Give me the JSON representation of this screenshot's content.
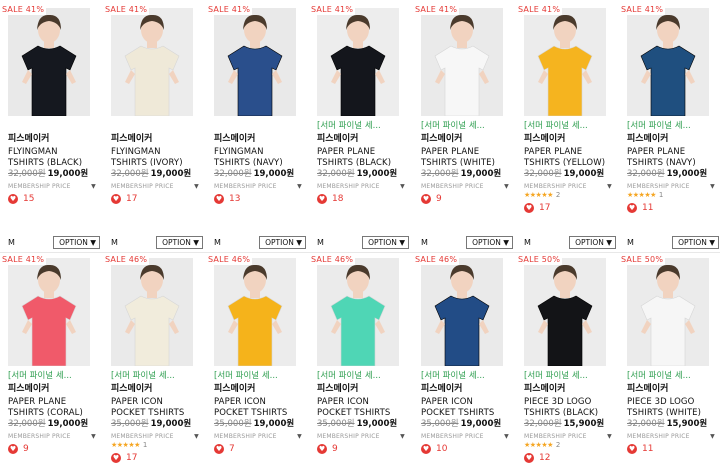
{
  "products": [
    {
      "sale": "SALE 41%",
      "tag": "",
      "brand": "피스메이커",
      "name": "FLYINGMAN\nTSHIRTS (BLACK)",
      "orig": "32,000원",
      "price": "19,000원",
      "member": "MEMBERSHIP PRICE",
      "rating": "",
      "rating_count": "",
      "likes": "15",
      "shirt": "#15181f",
      "bg": "#e9e9e9"
    },
    {
      "sale": "SALE 41%",
      "tag": "",
      "brand": "피스메이커",
      "name": "FLYINGMAN\nTSHIRTS (IVORY)",
      "orig": "32,000원",
      "price": "19,000원",
      "member": "MEMBERSHIP PRICE",
      "rating": "",
      "rating_count": "",
      "likes": "17",
      "shirt": "#efe9d8",
      "bg": "#ececec"
    },
    {
      "sale": "SALE 41%",
      "tag": "",
      "brand": "피스메이커",
      "name": "FLYINGMAN\nTSHIRTS (NAVY)",
      "orig": "32,000원",
      "price": "19,000원",
      "member": "MEMBERSHIP PRICE",
      "rating": "",
      "rating_count": "",
      "likes": "13",
      "shirt": "#2a4f8c",
      "bg": "#e9e9e9"
    },
    {
      "sale": "SALE 41%",
      "tag": "[서머 파이널 세...",
      "brand": "피스메이커",
      "name": "PAPER PLANE\nTSHIRTS (BLACK)",
      "orig": "32,000원",
      "price": "19,000원",
      "member": "MEMBERSHIP PRICE",
      "rating": "",
      "rating_count": "",
      "likes": "18",
      "shirt": "#14161c",
      "bg": "#ededed"
    },
    {
      "sale": "SALE 41%",
      "tag": "[서머 파이널 세...",
      "brand": "피스메이커",
      "name": "PAPER PLANE\nTSHIRTS (WHITE)",
      "orig": "32,000원",
      "price": "19,000원",
      "member": "MEMBERSHIP PRICE",
      "rating": "",
      "rating_count": "",
      "likes": "9",
      "shirt": "#f7f7f7",
      "bg": "#eaeaea"
    },
    {
      "sale": "SALE 41%",
      "tag": "[서머 파이널 세...",
      "brand": "피스메이커",
      "name": "PAPER PLANE\nTSHIRTS (YELLOW)",
      "orig": "32,000원",
      "price": "19,000원",
      "member": "MEMBERSHIP PRICE",
      "rating": "★★★★★",
      "rating_count": "2",
      "likes": "17",
      "shirt": "#f5b41f",
      "bg": "#ececec"
    },
    {
      "sale": "SALE 41%",
      "tag": "[서머 파이널 세...",
      "brand": "피스메이커",
      "name": "PAPER PLANE\nTSHIRTS (NAVY)",
      "orig": "32,000원",
      "price": "19,000원",
      "member": "MEMBERSHIP PRICE",
      "rating": "★★★★★",
      "rating_count": "1",
      "likes": "11",
      "shirt": "#1f4f7f",
      "bg": "#ebebeb"
    },
    {
      "sale": "SALE 41%",
      "tag": "[서머 파이널 세...",
      "brand": "피스메이커",
      "name": "PAPER PLANE\nTSHIRTS (CORAL)",
      "orig": "32,000원",
      "price": "19,000원",
      "member": "MEMBERSHIP PRICE",
      "rating": "",
      "rating_count": "",
      "likes": "9",
      "shirt": "#f05a6a",
      "bg": "#ececec"
    },
    {
      "sale": "SALE 46%",
      "tag": "[서머 파이널 세...",
      "brand": "피스메이커",
      "name": "PAPER ICON\nPOCKET TSHIRTS",
      "orig": "35,000원",
      "price": "19,000원",
      "member": "MEMBERSHIP PRICE",
      "rating": "★★★★★",
      "rating_count": "1",
      "likes": "17",
      "shirt": "#f1ecdc",
      "bg": "#eaeaea"
    },
    {
      "sale": "SALE 46%",
      "tag": "[서머 파이널 세...",
      "brand": "피스메이커",
      "name": "PAPER ICON\nPOCKET TSHIRTS",
      "orig": "35,000원",
      "price": "19,000원",
      "member": "MEMBERSHIP PRICE",
      "rating": "",
      "rating_count": "",
      "likes": "7",
      "shirt": "#f5b31b",
      "bg": "#ececec"
    },
    {
      "sale": "SALE 46%",
      "tag": "[서머 파이널 세...",
      "brand": "피스메이커",
      "name": "PAPER ICON\nPOCKET TSHIRTS",
      "orig": "35,000원",
      "price": "19,000원",
      "member": "MEMBERSHIP PRICE",
      "rating": "",
      "rating_count": "",
      "likes": "9",
      "shirt": "#4fd6b5",
      "bg": "#ebebeb"
    },
    {
      "sale": "SALE 46%",
      "tag": "[서머 파이널 세...",
      "brand": "피스메이커",
      "name": "PAPER ICON\nPOCKET TSHIRTS",
      "orig": "35,000원",
      "price": "19,000원",
      "member": "MEMBERSHIP PRICE",
      "rating": "",
      "rating_count": "",
      "likes": "10",
      "shirt": "#224c86",
      "bg": "#eaeaea"
    },
    {
      "sale": "SALE 50%",
      "tag": "[서머 파이널 세...",
      "brand": "피스메이커",
      "name": "PIECE 3D LOGO\nTSHIRTS (BLACK)",
      "orig": "32,000원",
      "price": "15,900원",
      "member": "MEMBERSHIP PRICE",
      "rating": "★★★★★",
      "rating_count": "2",
      "likes": "12",
      "shirt": "#131417",
      "bg": "#ececec"
    },
    {
      "sale": "SALE 50%",
      "tag": "[서머 파이널 세...",
      "brand": "피스메이커",
      "name": "PIECE 3D LOGO\nTSHIRTS (WHITE)",
      "orig": "32,000원",
      "price": "15,900원",
      "member": "MEMBERSHIP PRICE",
      "rating": "",
      "rating_count": "",
      "likes": "11",
      "shirt": "#f6f6f6",
      "bg": "#ebebeb"
    }
  ],
  "size_label": "M",
  "option_label": "OPTION ▼",
  "caret": "▼",
  "heart_glyph": "♥",
  "colors": {
    "sale": "#e53935",
    "tag": "#2e9e4f",
    "heart": "#e53935",
    "star": "#f5a623"
  }
}
